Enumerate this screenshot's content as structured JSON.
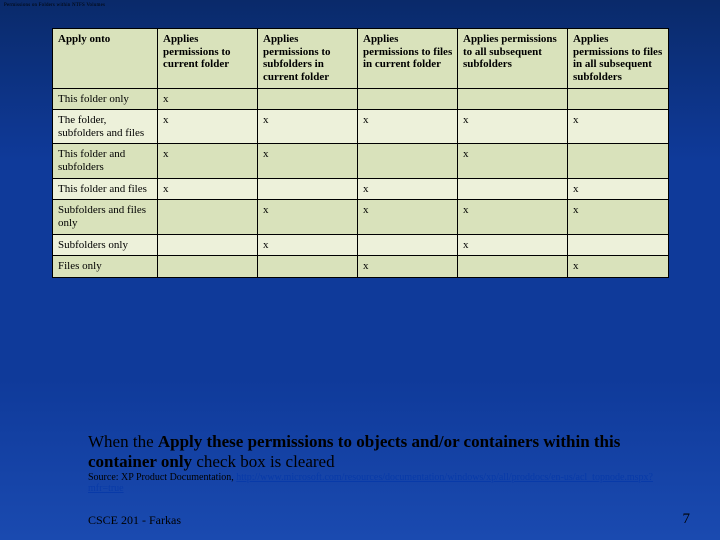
{
  "top_title": "Permissions on Folders within NTFS Volumes",
  "table": {
    "headers": [
      "Apply onto",
      "Applies permissions to current folder",
      "Applies permissions to subfolders in current folder",
      "Applies permissions to files in current folder",
      "Applies permissions to all subsequent subfolders",
      "Applies permissions to files in all subsequent subfolders"
    ],
    "rows": [
      {
        "label": "This folder only",
        "cells": [
          "x",
          "",
          "",
          "",
          ""
        ]
      },
      {
        "label": "The folder, subfolders and files",
        "cells": [
          "x",
          "x",
          "x",
          "x",
          "x"
        ]
      },
      {
        "label": "This folder and subfolders",
        "cells": [
          "x",
          "x",
          "",
          "x",
          ""
        ]
      },
      {
        "label": "This folder and files",
        "cells": [
          "x",
          "",
          "x",
          "",
          "x"
        ]
      },
      {
        "label": "Subfolders and files only",
        "cells": [
          "",
          "x",
          "x",
          "x",
          "x"
        ]
      },
      {
        "label": "Subfolders only",
        "cells": [
          "",
          "x",
          "",
          "x",
          ""
        ]
      },
      {
        "label": "Files only",
        "cells": [
          "",
          "",
          "x",
          "",
          "x"
        ]
      }
    ]
  },
  "note_prefix": "When the ",
  "note_bold": "Apply these permissions to objects and/or containers within this container only",
  "note_suffix": " check box is cleared",
  "source_label": "Source: XP Product Documentation, ",
  "source_url": "http://www.microsoft.com/resources/documentation/windows/xp/all/proddocs/en-us/acl_topnode.mspx?mfr=true",
  "footer_left": "CSCE 201 - Farkas",
  "footer_right": "7"
}
